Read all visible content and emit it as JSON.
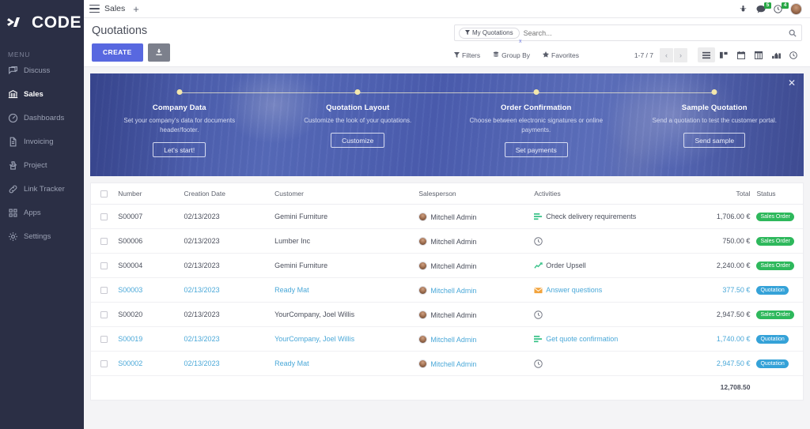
{
  "brand": {
    "name": "CODE",
    "logo_icon": "code-chevrons-icon"
  },
  "sidebar": {
    "menu_label": "MENU",
    "items": [
      {
        "label": "Discuss",
        "icon": "chat-icon",
        "active": false
      },
      {
        "label": "Sales",
        "icon": "sales-bank-icon",
        "active": true
      },
      {
        "label": "Dashboards",
        "icon": "gauge-icon",
        "active": false
      },
      {
        "label": "Invoicing",
        "icon": "document-icon",
        "active": false
      },
      {
        "label": "Project",
        "icon": "puzzle-icon",
        "active": false
      },
      {
        "label": "Link Tracker",
        "icon": "link-icon",
        "active": false
      },
      {
        "label": "Apps",
        "icon": "grid-apps-icon",
        "active": false
      },
      {
        "label": "Settings",
        "icon": "gear-icon",
        "active": false
      }
    ]
  },
  "topbar": {
    "menu_icon": "hamburger-icon",
    "app_name": "Sales",
    "add_label": "+",
    "icons": [
      {
        "name": "bug-icon",
        "badge": null
      },
      {
        "name": "messages-icon",
        "badge": "5"
      },
      {
        "name": "activity-clock-icon",
        "badge": "4"
      }
    ],
    "avatar": "user-avatar"
  },
  "control_panel": {
    "title": "Quotations",
    "create_label": "CREATE",
    "upload_icon": "upload-icon",
    "search": {
      "facet_label": "My Quotations",
      "facet_icon": "filter-icon",
      "placeholder": "Search...",
      "value": "",
      "search_icon": "search-icon",
      "remove_facet": "x"
    },
    "tools": [
      {
        "label": "Filters",
        "icon": "filter-icon"
      },
      {
        "label": "Group By",
        "icon": "group-icon"
      },
      {
        "label": "Favorites",
        "icon": "star-icon"
      }
    ],
    "pager": {
      "count": "1-7 / 7",
      "prev": "‹",
      "next": "›"
    },
    "views": [
      {
        "name": "list-view-icon",
        "active": true
      },
      {
        "name": "kanban-view-icon",
        "active": false
      },
      {
        "name": "calendar-view-icon",
        "active": false
      },
      {
        "name": "pivot-view-icon",
        "active": false
      },
      {
        "name": "graph-view-icon",
        "active": false
      },
      {
        "name": "activity-view-icon",
        "active": false
      }
    ]
  },
  "banner": {
    "close_icon": "close-icon",
    "steps": [
      {
        "title": "Company Data",
        "desc": "Set your company's data for documents header/footer.",
        "button": "Let's start!"
      },
      {
        "title": "Quotation Layout",
        "desc": "Customize the look of your quotations.",
        "button": "Customize"
      },
      {
        "title": "Order Confirmation",
        "desc": "Choose between electronic signatures or online payments.",
        "button": "Set payments"
      },
      {
        "title": "Sample Quotation",
        "desc": "Send a quotation to test the customer portal.",
        "button": "Send sample"
      }
    ]
  },
  "list": {
    "columns": [
      "Number",
      "Creation Date",
      "Customer",
      "Salesperson",
      "Activities",
      "Total",
      "Status"
    ],
    "rows": [
      {
        "number": "S00007",
        "date": "02/13/2023",
        "customer": "Gemini Furniture",
        "salesperson": "Mitchell Admin",
        "activity": "Check delivery requirements",
        "activity_icon": "list-green-icon",
        "total": "1,706.00 €",
        "status": "Sales Order",
        "status_type": "so",
        "link": false
      },
      {
        "number": "S00006",
        "date": "02/13/2023",
        "customer": "Lumber Inc",
        "salesperson": "Mitchell Admin",
        "activity": "",
        "activity_icon": "clock-icon",
        "total": "750.00 €",
        "status": "Sales Order",
        "status_type": "so",
        "link": false
      },
      {
        "number": "S00004",
        "date": "02/13/2023",
        "customer": "Gemini Furniture",
        "salesperson": "Mitchell Admin",
        "activity": "Order Upsell",
        "activity_icon": "chart-green-icon",
        "total": "2,240.00 €",
        "status": "Sales Order",
        "status_type": "so",
        "link": false
      },
      {
        "number": "S00003",
        "date": "02/13/2023",
        "customer": "Ready Mat",
        "salesperson": "Mitchell Admin",
        "activity": "Answer questions",
        "activity_icon": "mail-orange-icon",
        "total": "377.50 €",
        "status": "Quotation",
        "status_type": "qt",
        "link": true
      },
      {
        "number": "S00020",
        "date": "02/13/2023",
        "customer": "YourCompany, Joel Willis",
        "salesperson": "Mitchell Admin",
        "activity": "",
        "activity_icon": "clock-icon",
        "total": "2,947.50 €",
        "status": "Sales Order",
        "status_type": "so",
        "link": false
      },
      {
        "number": "S00019",
        "date": "02/13/2023",
        "customer": "YourCompany, Joel Willis",
        "salesperson": "Mitchell Admin",
        "activity": "Get quote confirmation",
        "activity_icon": "list-green-icon",
        "total": "1,740.00 €",
        "status": "Quotation",
        "status_type": "qt",
        "link": true
      },
      {
        "number": "S00002",
        "date": "02/13/2023",
        "customer": "Ready Mat",
        "salesperson": "Mitchell Admin",
        "activity": "",
        "activity_icon": "clock-icon",
        "total": "2,947.50 €",
        "status": "Quotation",
        "status_type": "qt",
        "link": true
      }
    ],
    "grand_total": "12,708.50"
  },
  "colors": {
    "sidebar_bg": "#2b2f45",
    "primary": "#5868e0",
    "banner_bg": "#4f60b0",
    "link": "#4aa8d8",
    "status_sales_order": "#2eb85c",
    "status_quotation": "#35a2d8",
    "badge_green": "#28a745"
  }
}
